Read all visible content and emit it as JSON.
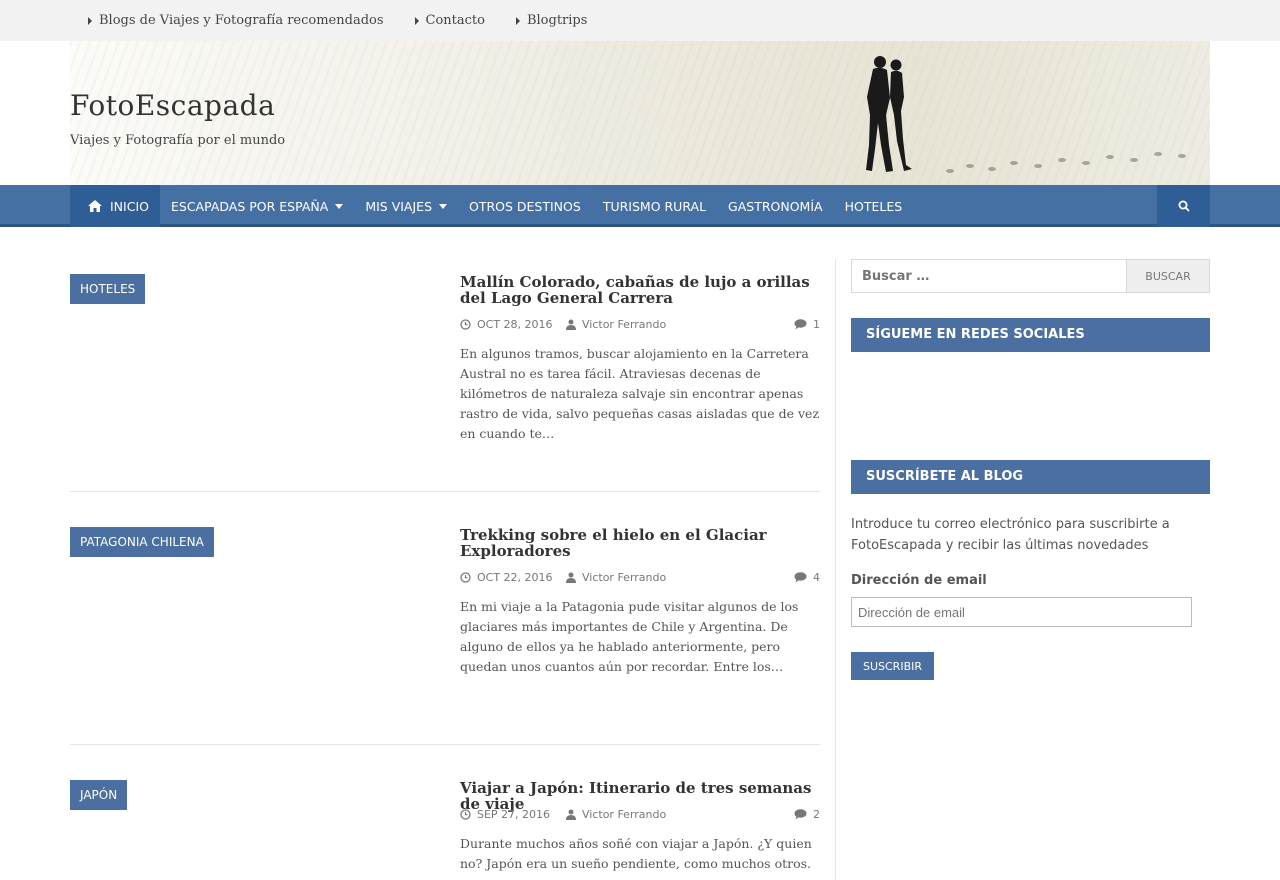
{
  "topnav": {
    "items": [
      {
        "label": "Blogs de Viajes y Fotografía recomendados"
      },
      {
        "label": "Contacto"
      },
      {
        "label": "Blogtrips"
      }
    ]
  },
  "header": {
    "title": "FotoEscapada",
    "tagline": "Viajes y Fotografía por el mundo"
  },
  "mainnav": {
    "items": [
      {
        "label": "Inicio",
        "icon": "home-icon",
        "active": true
      },
      {
        "label": "Escapadas por España",
        "dropdown": true
      },
      {
        "label": "Mis Viajes",
        "dropdown": true
      },
      {
        "label": "Otros Destinos"
      },
      {
        "label": "Turismo Rural"
      },
      {
        "label": "Gastronomía"
      },
      {
        "label": "Hoteles"
      }
    ],
    "search_icon": "search-icon"
  },
  "posts": [
    {
      "category": "Hoteles",
      "title": "Mallín Colorado, cabañas de lujo a orillas del Lago General Carrera",
      "date": "OCT 28, 2016",
      "author": "Victor Ferrando",
      "comments": "1",
      "excerpt": "En algunos tramos, buscar alojamiento en la Carretera Austral no es tarea fácil. Atraviesas decenas de kilómetros de naturaleza salvaje sin encontrar apenas rastro de vida, salvo pequeñas casas aisladas que de vez en cuando te…"
    },
    {
      "category": "Patagonia Chilena",
      "title": "Trekking sobre el hielo en el Glaciar Exploradores",
      "date": "OCT 22, 2016",
      "author": "Victor Ferrando",
      "comments": "4",
      "excerpt": "En mi viaje a la Patagonia pude visitar algunos de los glaciares más importantes de Chile y Argentina. De alguno de ellos ya he hablado anteriormente, pero quedan unos cuantos aún por recordar. Entre los…"
    },
    {
      "category": "Japón",
      "title": "Viajar a Japón: Itinerario de tres semanas de viaje",
      "date": "SEP 27, 2016",
      "author": "Victor Ferrando",
      "comments": "2",
      "excerpt": "Durante muchos años soñé con viajar a Japón. ¿Y quien no? Japón era un sueño pendiente, como muchos otros."
    }
  ],
  "sidebar": {
    "search_placeholder": "Buscar …",
    "search_button": "Buscar",
    "social_title": "Sígueme en redes sociales",
    "subscribe_title": "Suscríbete al blog",
    "subscribe_intro": "Introduce tu correo electrónico para suscribirte a FotoEscapada y recibir las últimas novedades",
    "email_label": "Dirección de email",
    "email_placeholder": "Dirección de email",
    "subscribe_button": "Suscribir"
  },
  "colors": {
    "nav_blue": "#4470a4",
    "nav_active": "#2f5e96",
    "badge_blue": "#4a6fa0"
  }
}
